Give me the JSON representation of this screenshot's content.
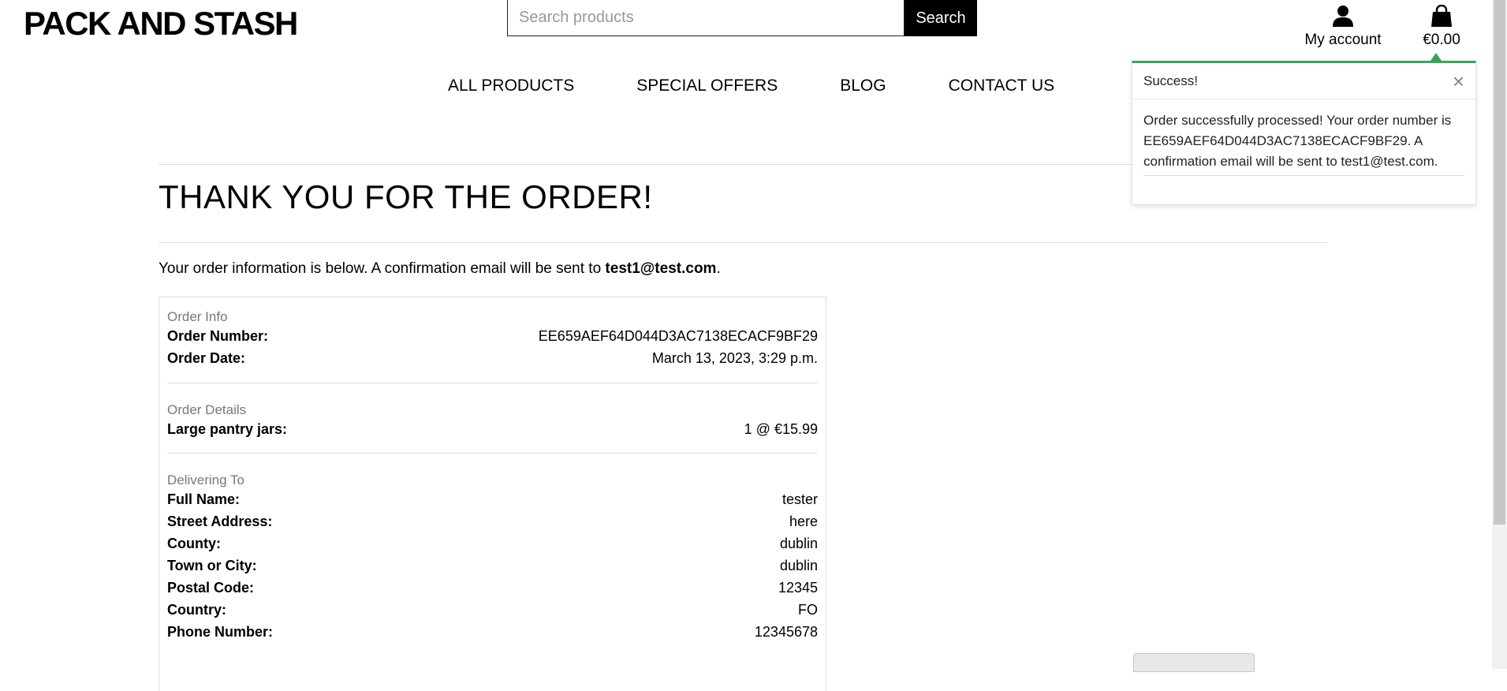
{
  "brand": "PACK AND STASH",
  "search": {
    "placeholder": "Search products",
    "button": "Search"
  },
  "account": {
    "label": "My account",
    "icon": "user-icon"
  },
  "bag": {
    "total": "€0.00",
    "icon": "shopping-bag-icon"
  },
  "nav": [
    "ALL PRODUCTS",
    "SPECIAL OFFERS",
    "BLOG",
    "CONTACT US"
  ],
  "page": {
    "title": "THANK YOU FOR THE ORDER!",
    "intro_prefix": "Your order information is below. A confirmation email will be sent to ",
    "email": "test1@test.com",
    "intro_suffix": "."
  },
  "order_info": {
    "heading": "Order Info",
    "rows": [
      {
        "label": "Order Number:",
        "value": "EE659AEF64D044D3AC7138ECACF9BF29"
      },
      {
        "label": "Order Date:",
        "value": "March 13, 2023, 3:29 p.m."
      }
    ]
  },
  "order_details": {
    "heading": "Order Details",
    "rows": [
      {
        "label": "Large pantry jars:",
        "value": "1 @ €15.99"
      }
    ]
  },
  "delivering_to": {
    "heading": "Delivering To",
    "rows": [
      {
        "label": "Full Name:",
        "value": "tester"
      },
      {
        "label": "Street Address:",
        "value": "here"
      },
      {
        "label": "County:",
        "value": "dublin"
      },
      {
        "label": "Town or City:",
        "value": "dublin"
      },
      {
        "label": "Postal Code:",
        "value": "12345"
      },
      {
        "label": "Country:",
        "value": "FO"
      },
      {
        "label": "Phone Number:",
        "value": "12345678"
      }
    ]
  },
  "toast": {
    "title": "Success!",
    "close": "×",
    "message": "Order successfully processed! Your order number is EE659AEF64D044D3AC7138ECACF9BF29. A confirmation email will be sent to test1@test.com.",
    "accent_color": "#3aa655"
  }
}
